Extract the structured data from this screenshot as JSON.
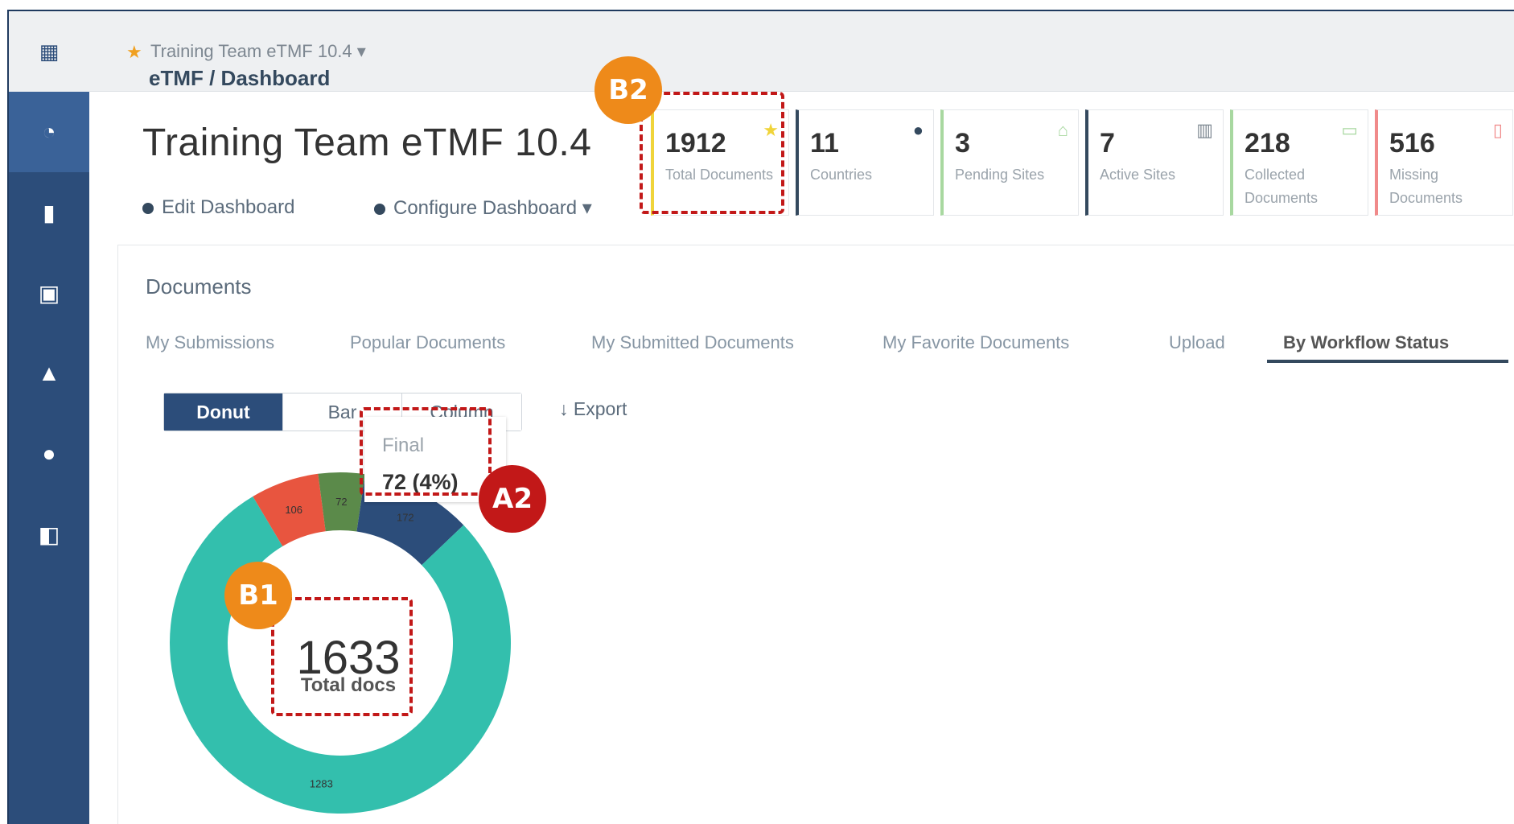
{
  "header": {
    "apps_icon": "apps-grid-icon",
    "study_name": "Training Team eTMF 10.4",
    "breadcrumb": "eTMF / Dashboard"
  },
  "sidebar": {
    "items": [
      {
        "icon": "dashboard-icon",
        "glyph": "◔"
      },
      {
        "icon": "document-icon",
        "glyph": "▮"
      },
      {
        "icon": "site-icon",
        "glyph": "▣"
      },
      {
        "icon": "lab-flask-icon",
        "glyph": "▲"
      },
      {
        "icon": "user-icon",
        "glyph": "●"
      },
      {
        "icon": "copy-icon",
        "glyph": "◧"
      }
    ]
  },
  "page": {
    "title": "Training Team eTMF 10.4",
    "edit_dashboard": "Edit Dashboard",
    "configure_dashboard": "Configure Dashboard ▾"
  },
  "stats": [
    {
      "value": "1912",
      "label": "Total Documents",
      "color": "#f0d43a",
      "icon": "star-icon"
    },
    {
      "value": "11",
      "label": "Countries",
      "color": "#34495e",
      "icon": "globe-icon"
    },
    {
      "value": "3",
      "label": "Pending Sites",
      "color": "#a8d8a0",
      "icon": "home-icon"
    },
    {
      "value": "7",
      "label": "Active Sites",
      "color": "#34495e",
      "icon": "building-icon"
    },
    {
      "value": "218",
      "label": "Collected Documents",
      "color": "#a8d8a0",
      "icon": "inbox-icon"
    },
    {
      "value": "516",
      "label": "Missing Documents",
      "color": "#f08a8a",
      "icon": "file-icon"
    }
  ],
  "documents": {
    "title": "Documents",
    "tabs": [
      "My Submissions",
      "Popular Documents",
      "My Submitted Documents",
      "My Favorite Documents",
      "Upload",
      "By Workflow Status"
    ],
    "chart_buttons": [
      "Donut",
      "Bar",
      "Column"
    ],
    "export": "Export"
  },
  "tooltip": {
    "name": "Final",
    "value": "72 (4%)"
  },
  "annotations": {
    "b1": "B1",
    "b2": "B2",
    "a2": "A2"
  },
  "chart_data": {
    "type": "pie",
    "center_value": "1633",
    "center_label": "Total docs",
    "slices": [
      {
        "label": "106",
        "value": 106,
        "color": "#e8553f"
      },
      {
        "label": "72",
        "value": 72,
        "color": "#5b8a4a"
      },
      {
        "label": "172",
        "value": 172,
        "color": "#2c4d7a"
      },
      {
        "label": "1283",
        "value": 1283,
        "color": "#33bfad"
      }
    ]
  }
}
